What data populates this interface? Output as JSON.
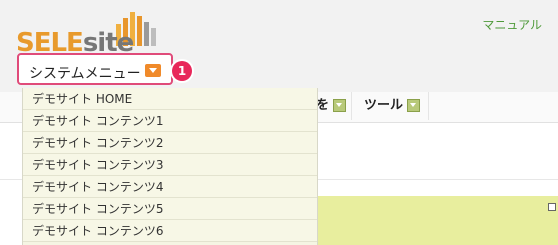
{
  "header": {
    "logo_sele": "SELE",
    "logo_site": "site",
    "manual_link": "マニュアル",
    "system_menu_label": "システムメニュー",
    "callout_badge": "1"
  },
  "nav": {
    "partial_item": "を",
    "tools_label": "ツール"
  },
  "dropdown": {
    "items": [
      "デモサイト HOME",
      "デモサイト コンテンツ1",
      "デモサイト コンテンツ2",
      "デモサイト コンテンツ3",
      "デモサイト コンテンツ4",
      "デモサイト コンテンツ5",
      "デモサイト コンテンツ6"
    ]
  },
  "colors": {
    "accent_orange": "#f08a2a",
    "highlight_pink": "#e04b7a",
    "link_green": "#4f9a3a",
    "dropdown_bg": "#f5f5e3",
    "panel_yellow": "#e8ee9e"
  }
}
